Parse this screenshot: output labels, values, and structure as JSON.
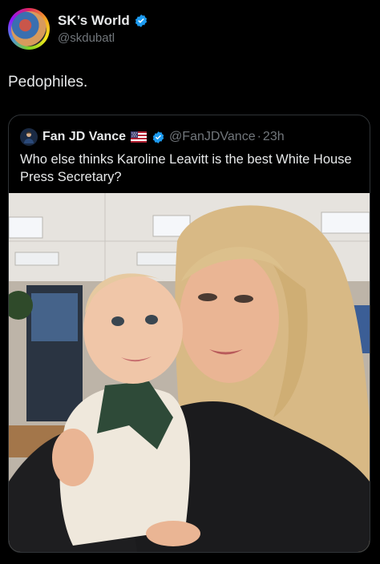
{
  "tweet": {
    "author_name": "SK’s World",
    "author_handle": "@skdubatl",
    "text": "Pedophiles."
  },
  "quote": {
    "author_name": "Fan JD Vance",
    "author_handle": "@FanJDVance",
    "separator": "·",
    "time": "23h",
    "text": "Who else thinks Karoline Leavitt is the best White House Press Secretary?"
  },
  "colors": {
    "background": "#000000",
    "text": "#e7e9ea",
    "secondary_text": "#71767b",
    "verified_blue": "#1d9bf0",
    "border": "#2f3336"
  }
}
